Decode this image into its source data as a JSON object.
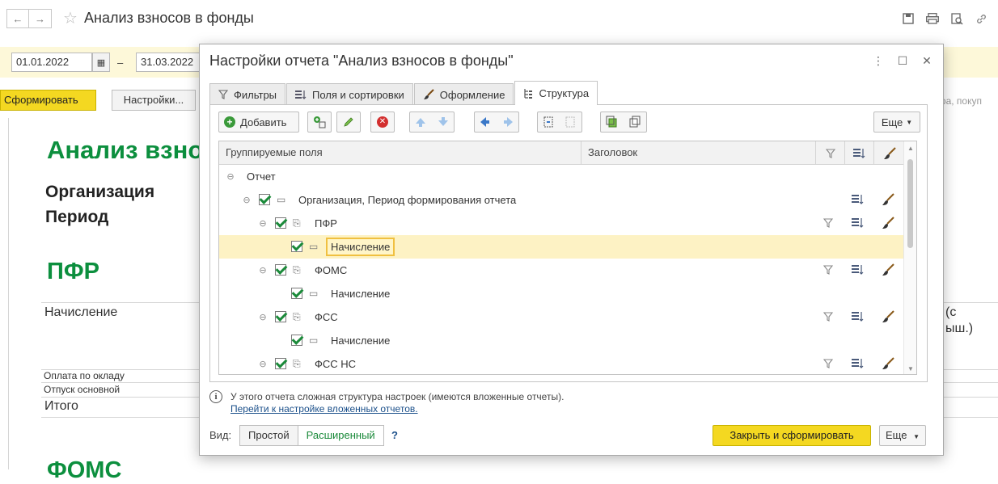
{
  "window": {
    "title": "Анализ взносов в фонды",
    "nav_back": "←",
    "nav_forward": "→"
  },
  "period": {
    "from": "01.01.2022",
    "dash": "–",
    "to": "31.03.2022"
  },
  "actions": {
    "generate_label": "Сформировать",
    "settings_label": "Настройки...",
    "search_stub": "вара, покуп"
  },
  "report": {
    "title": "Анализ взносов в фонды",
    "organization_label": "Организация",
    "period_label": "Период",
    "section_pfr": "ПФР",
    "accrual_label": "Начисление",
    "right_col_line1": "(с",
    "right_col_line2": "ыш.)",
    "row_salary": "Оплата по окладу",
    "row_vacation": "Отпуск основной",
    "total_label": "Итого",
    "section_foms": "ФОМС"
  },
  "dialog": {
    "title": "Настройки отчета \"Анализ взносов в фонды\"",
    "tabs": [
      {
        "label": "Фильтры",
        "icon": "filter-icon"
      },
      {
        "label": "Поля и сортировки",
        "icon": "fields-sort-icon"
      },
      {
        "label": "Оформление",
        "icon": "brush-icon"
      },
      {
        "label": "Структура",
        "icon": "structure-icon"
      }
    ],
    "toolbar": {
      "add_label": "Добавить",
      "more_label": "Еще"
    },
    "grid": {
      "col_fields": "Группируемые поля",
      "col_header": "Заголовок",
      "rows": [
        {
          "label": "Отчет"
        },
        {
          "label": "Организация, Период формирования отчета"
        },
        {
          "label": "ПФР"
        },
        {
          "label": "Начисление"
        },
        {
          "label": "ФОМС"
        },
        {
          "label": "Начисление"
        },
        {
          "label": "ФСС"
        },
        {
          "label": "Начисление"
        },
        {
          "label": "ФСС НС"
        }
      ]
    },
    "info_text": "У этого отчета сложная структура настроек (имеются вложенные отчеты).",
    "info_link": "Перейти к настройке вложенных отчетов.",
    "footer": {
      "view_label": "Вид:",
      "mode_simple": "Простой",
      "mode_extended": "Расширенный",
      "help": "?",
      "close_generate": "Закрыть и сформировать",
      "more_label": "Еще"
    }
  },
  "colors": {
    "accent_yellow": "#f4d821",
    "report_green": "#0c8f3e",
    "selected_row": "#fdf2c4"
  }
}
